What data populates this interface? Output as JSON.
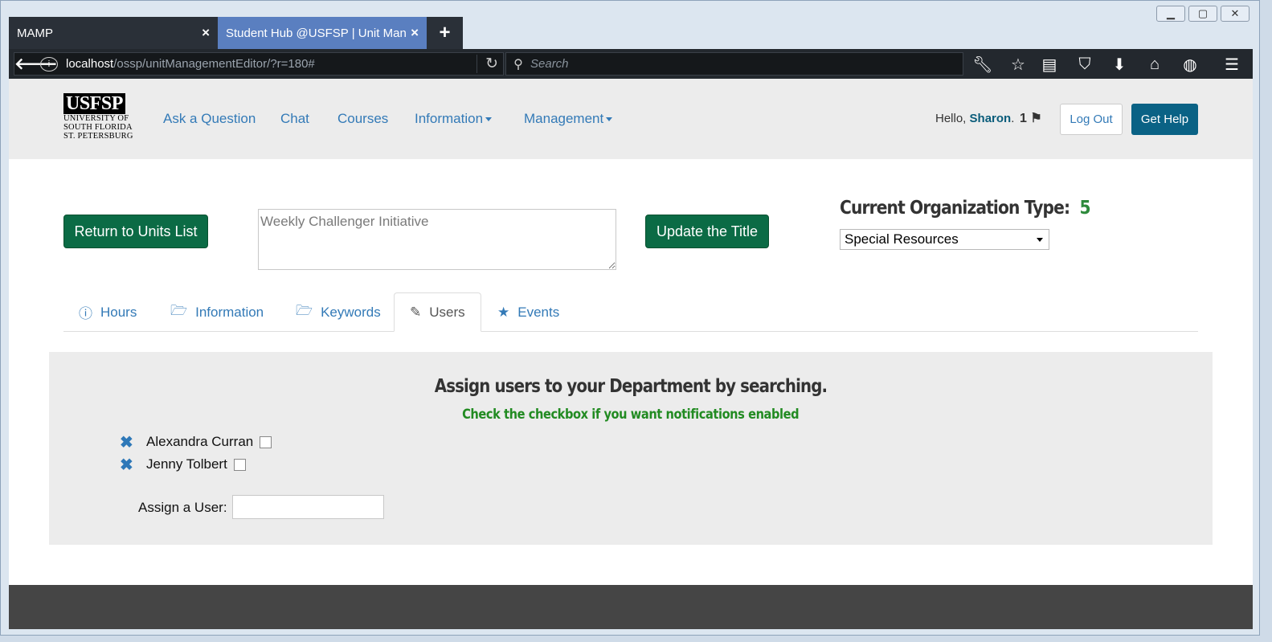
{
  "browser": {
    "tabs": [
      {
        "title": "MAMP",
        "close": "×"
      },
      {
        "title": "Student Hub @USFSP | Unit Mana",
        "close": "×"
      }
    ],
    "new_tab": "+",
    "url_host": "localhost",
    "url_path": "/ossp/unitManagementEditor/?r=180#",
    "search_placeholder": "Search",
    "icons": [
      "back-icon",
      "info-icon",
      "reload-icon",
      "search-icon",
      "wrench-icon",
      "star-icon",
      "reader-icon",
      "pocket-icon",
      "download-icon",
      "home-icon",
      "globe-icon",
      "menu-icon"
    ]
  },
  "header": {
    "logo_main": "USFSP",
    "logo_line1": "UNIVERSITY OF",
    "logo_line2": "SOUTH FLORIDA",
    "logo_line3": "ST. PETERSBURG",
    "nav": [
      {
        "label": "Ask a Question"
      },
      {
        "label": "Chat"
      },
      {
        "label": "Courses"
      },
      {
        "label": "Information"
      },
      {
        "label": "Management"
      }
    ],
    "greeting_prefix": "Hello,",
    "user_name": "Sharon",
    "greeting_suffix": ".",
    "notification_count": "1",
    "logout_label": "Log Out",
    "help_label": "Get Help"
  },
  "editor": {
    "return_label": "Return to Units List",
    "title_value": "Weekly Challenger Initiative",
    "update_label": "Update the Title",
    "org_type_label": "Current Organization Type:",
    "org_type_value": "5",
    "org_select_value": "Special Resources"
  },
  "tabs": [
    {
      "label": "Hours",
      "icon": "info-circle-icon"
    },
    {
      "label": "Information",
      "icon": "folder-open-icon"
    },
    {
      "label": "Keywords",
      "icon": "folder-open-icon"
    },
    {
      "label": "Users",
      "icon": "pencil-icon",
      "active": true
    },
    {
      "label": "Events",
      "icon": "star-icon"
    }
  ],
  "users_panel": {
    "heading": "Assign users to your Department by searching.",
    "subheading": "Check the checkbox if you want notifications enabled",
    "users": [
      {
        "name": "Alexandra Curran",
        "notify": false
      },
      {
        "name": "Jenny Tolbert",
        "notify": false
      }
    ],
    "assign_label": "Assign a User:",
    "assign_value": ""
  },
  "colors": {
    "brand_green": "#0b6b45",
    "link_blue": "#337ab7",
    "help_blue": "#0a6285",
    "notify_green": "#228b22"
  }
}
